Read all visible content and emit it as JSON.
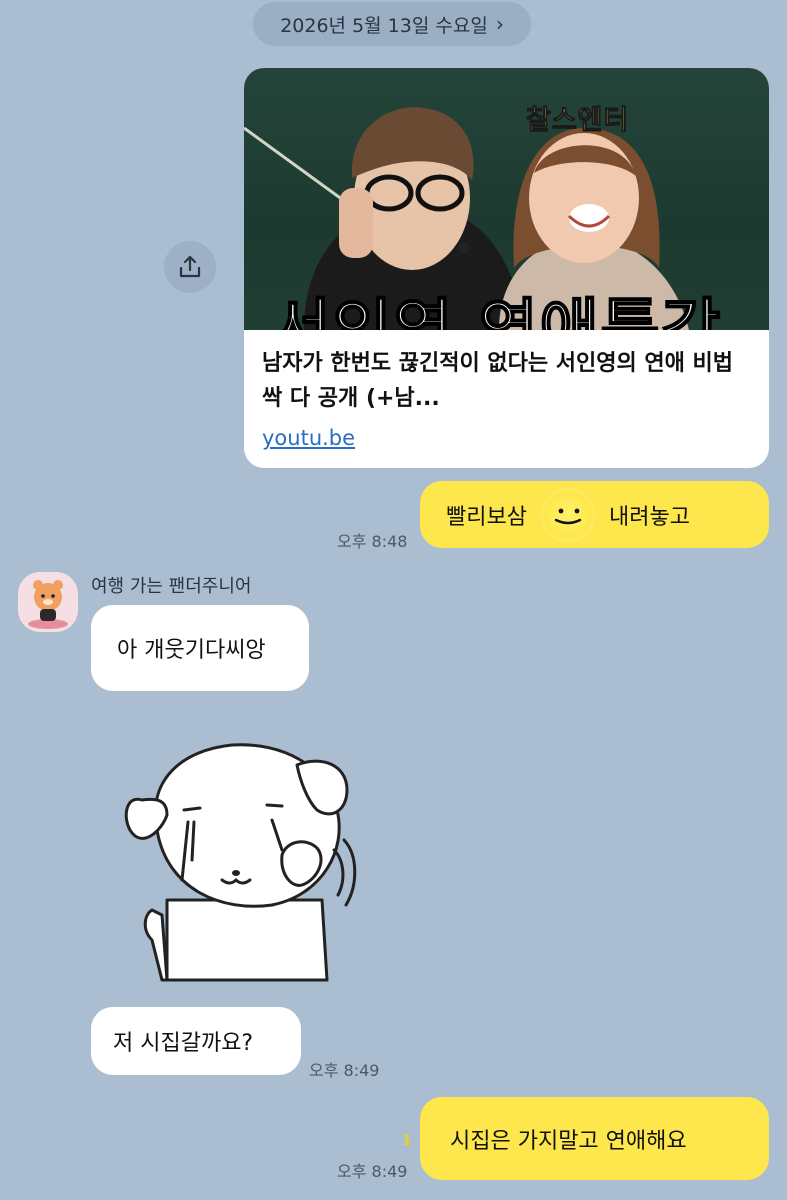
{
  "date_divider": {
    "label": "2026년 5월 13일 수요일",
    "chevron": "›"
  },
  "share": {
    "icon": "share-upload-icon"
  },
  "link_card": {
    "thumbnail_tag": "찰스엔터",
    "thumbnail_title": "서인영 연애특강",
    "title": "남자가 한번도 끊긴적이 없다는 서인영의 연애 비법 싹 다 공개 (+남...",
    "url": "youtu.be"
  },
  "messages": [
    {
      "from": "me",
      "text_before": "빨리보삼",
      "emoji": "sleepy-face-emoji",
      "text_after": "내려놓고",
      "time": "오후 8:48"
    },
    {
      "from": "other",
      "sender": "여행 가는 팬더주니어",
      "text": "아 개웃기다씨앙"
    },
    {
      "from": "other",
      "type": "sticker",
      "sticker": "crying-dog-sticker"
    },
    {
      "from": "other",
      "text": "저 시집갈까요?",
      "time": "오후 8:49"
    },
    {
      "from": "me",
      "text": "시집은 가지말고 연애해요",
      "time": "오후 8:49",
      "unread": "1"
    }
  ],
  "colors": {
    "background": "#abbdd1",
    "my_bubble": "#fde74c",
    "other_bubble": "#ffffff"
  }
}
